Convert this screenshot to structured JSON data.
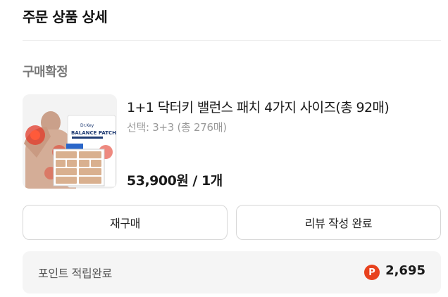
{
  "header": {
    "title": "주문 상품 상세"
  },
  "order": {
    "status": "구매확정"
  },
  "product": {
    "name": "1+1 닥터키 밸런스 패치 4가지 사이즈(총 92매)",
    "option": "선택: 3+3 (총 276매)",
    "price": "53,900원 / 1개",
    "package_brand": "Dr.Key",
    "package_title": "BALANCE PATCH"
  },
  "actions": {
    "rebuy_label": "재구매",
    "review_label": "리뷰 작성 완료"
  },
  "points": {
    "label": "포인트 적립완료",
    "icon_letter": "P",
    "value": "2,695",
    "icon_color": "#e8421e"
  }
}
